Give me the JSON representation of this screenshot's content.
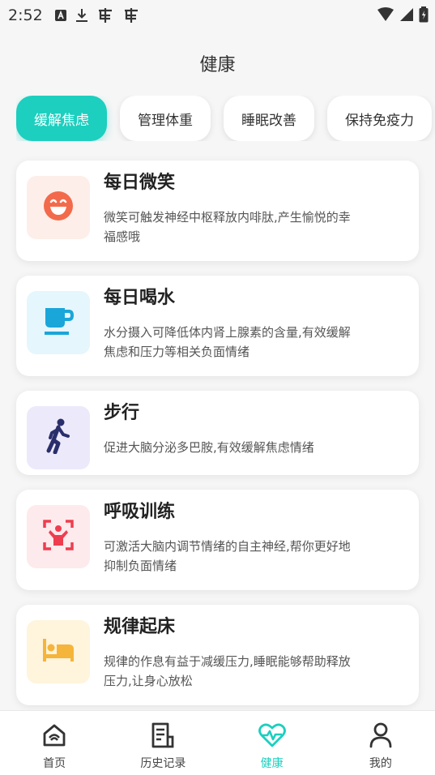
{
  "status_bar": {
    "time": "2:52"
  },
  "page": {
    "title": "健康"
  },
  "tabs": [
    {
      "label": "缓解焦虑",
      "active": true
    },
    {
      "label": "管理体重",
      "active": false
    },
    {
      "label": "睡眠改善",
      "active": false
    },
    {
      "label": "保持免疫力",
      "active": false
    }
  ],
  "cards": [
    {
      "title": "每日微笑",
      "desc": "微笑可触发神经中枢释放内啡肽,产生愉悦的幸福感哦",
      "icon": "smile-icon",
      "bg": "#fdeee9",
      "color": "#f26a4b"
    },
    {
      "title": "每日喝水",
      "desc": "水分摄入可降低体内肾上腺素的含量,有效缓解焦虑和压力等相关负面情绪",
      "icon": "cup-icon",
      "bg": "#e5f6fc",
      "color": "#1aa6d9"
    },
    {
      "title": "步行",
      "desc": "促进大脑分泌多巴胺,有效缓解焦虑情绪",
      "icon": "walk-icon",
      "bg": "#ece9fb",
      "color": "#2a2f6b"
    },
    {
      "title": "呼吸训练",
      "desc": "可激活大脑内调节情绪的自主神经,帮你更好地抑制负面情绪",
      "icon": "breath-icon",
      "bg": "#fdeaec",
      "color": "#ee3d4f"
    },
    {
      "title": "规律起床",
      "desc": "规律的作息有益于减缓压力,睡眠能够帮助释放压力,让身心放松",
      "icon": "bed-icon",
      "bg": "#fff4dc",
      "color": "#f5b53a"
    }
  ],
  "nav": [
    {
      "label": "首页",
      "icon": "home-icon",
      "active": false
    },
    {
      "label": "历史记录",
      "icon": "history-icon",
      "active": false
    },
    {
      "label": "健康",
      "icon": "heart-pulse-icon",
      "active": true
    },
    {
      "label": "我的",
      "icon": "person-icon",
      "active": false
    }
  ],
  "colors": {
    "accent": "#1ccfbf"
  }
}
